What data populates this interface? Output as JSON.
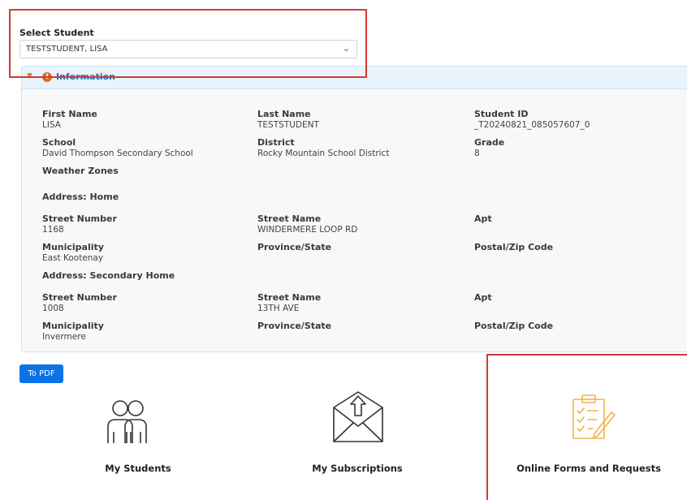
{
  "student_select": {
    "label": "Select Student",
    "selected": "TESTSTUDENT, LISA"
  },
  "info": {
    "title": "Information",
    "first_name": {
      "label": "First Name",
      "value": "LISA"
    },
    "last_name": {
      "label": "Last Name",
      "value": "TESTSTUDENT"
    },
    "student_id": {
      "label": "Student ID",
      "value": "_T20240821_085057607_0"
    },
    "school": {
      "label": "School",
      "value": "David Thompson Secondary School"
    },
    "district": {
      "label": "District",
      "value": "Rocky Mountain School District"
    },
    "grade": {
      "label": "Grade",
      "value": "8"
    },
    "weather_zones": {
      "label": "Weather Zones"
    },
    "home": {
      "heading": "Address: Home",
      "street_number": {
        "label": "Street Number",
        "value": "1168"
      },
      "street_name": {
        "label": "Street Name",
        "value": "WINDERMERE LOOP RD"
      },
      "apt": {
        "label": "Apt"
      },
      "municipality": {
        "label": "Municipality",
        "value": "East Kootenay"
      },
      "province": {
        "label": "Province/State"
      },
      "postal": {
        "label": "Postal/Zip Code"
      }
    },
    "secondary": {
      "heading": "Address: Secondary Home",
      "street_number": {
        "label": "Street Number",
        "value": "1008"
      },
      "street_name": {
        "label": "Street Name",
        "value": "13TH AVE"
      },
      "apt": {
        "label": "Apt"
      },
      "municipality": {
        "label": "Municipality",
        "value": "Invermere"
      },
      "province": {
        "label": "Province/State"
      },
      "postal": {
        "label": "Postal/Zip Code"
      }
    }
  },
  "pdf_button": "To PDF",
  "tiles": [
    {
      "label": "My Students",
      "icon": "students-icon",
      "color": "#333333"
    },
    {
      "label": "My Subscriptions",
      "icon": "envelope-icon",
      "color": "#333333"
    },
    {
      "label": "Online Forms and Requests",
      "icon": "clipboard-checklist-icon",
      "color": "#f0b24a"
    }
  ],
  "colors": {
    "accent": "#0b73e6",
    "annotation": "#d23a2f",
    "header_text": "#1a73c9"
  }
}
